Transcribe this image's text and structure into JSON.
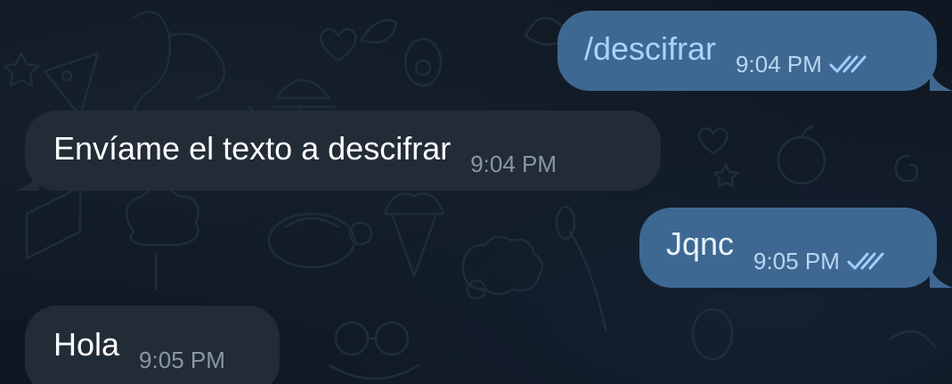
{
  "chat": {
    "messages": [
      {
        "direction": "outgoing",
        "text": "/descifrar",
        "time": "9:04 PM",
        "status_icon": "double-check-icon"
      },
      {
        "direction": "incoming",
        "text": "Envíame el texto a descifrar",
        "time": "9:04 PM"
      },
      {
        "direction": "outgoing",
        "text": "Jqnc",
        "time": "9:05 PM",
        "status_icon": "double-check-icon"
      },
      {
        "direction": "incoming",
        "text": "Hola",
        "time": "9:05 PM"
      }
    ]
  },
  "colors": {
    "outgoing_bubble": "#3e6891",
    "incoming_bubble": "#222c37",
    "background": "#0f1822",
    "command_text": "#a9d4ff",
    "outgoing_time": "#b9d6f2",
    "incoming_time": "#8a96a3"
  }
}
